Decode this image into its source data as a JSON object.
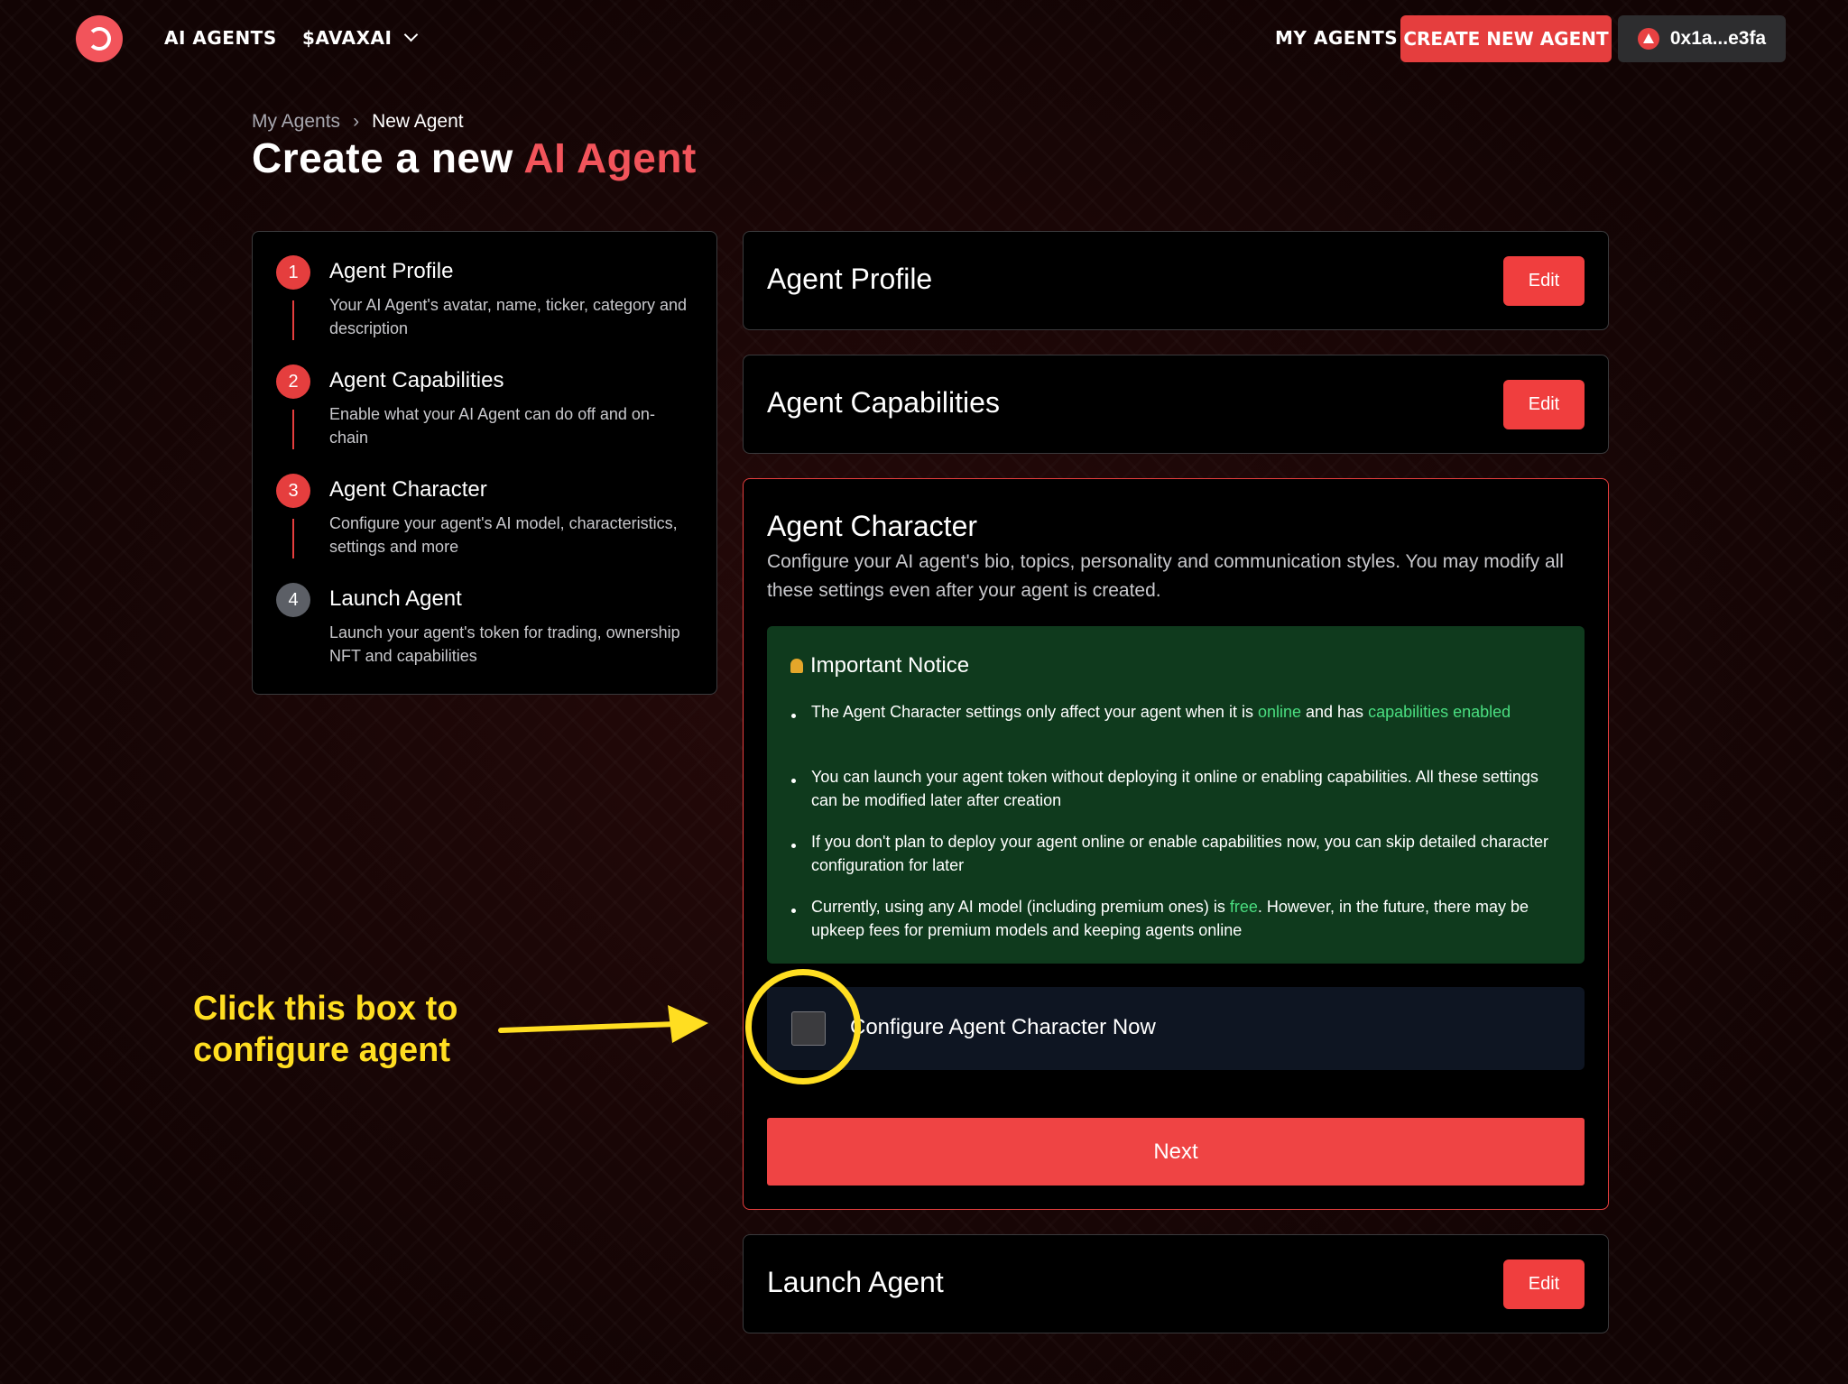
{
  "nav": {
    "links": [
      "AI AGENTS",
      "$AVAXAI"
    ],
    "my_agents": "MY AGENTS",
    "create": "CREATE NEW AGENT",
    "wallet": "0x1a...e3fa"
  },
  "breadcrumb": {
    "parent": "My Agents",
    "current": "New Agent"
  },
  "title": {
    "prefix": "Create a new",
    "highlight": "AI Agent"
  },
  "steps": [
    {
      "num": "1",
      "title": "Agent Profile",
      "desc": "Your AI Agent's avatar, name, ticker, category and description"
    },
    {
      "num": "2",
      "title": "Agent Capabilities",
      "desc": "Enable what your AI Agent can do off and on-chain"
    },
    {
      "num": "3",
      "title": "Agent Character",
      "desc": "Configure your agent's AI model, characteristics, settings and more"
    },
    {
      "num": "4",
      "title": "Launch Agent",
      "desc": "Launch your agent's token for trading, ownership NFT and capabilities"
    }
  ],
  "cards": {
    "profile": {
      "title": "Agent Profile",
      "edit": "Edit"
    },
    "capabilities": {
      "title": "Agent Capabilities",
      "edit": "Edit"
    },
    "character": {
      "title": "Agent Character",
      "desc": "Configure your AI agent's bio, topics, personality and communication styles. You may modify all these settings even after your agent is created."
    },
    "launch": {
      "title": "Launch Agent",
      "edit": "Edit"
    }
  },
  "notice": {
    "title": "Important Notice",
    "b1": {
      "pre": "The Agent Character settings only affect your agent when it is ",
      "g1": "online",
      "mid": " and has ",
      "g2": "capabilities enabled"
    },
    "b2": "You can launch your agent token without deploying it online or enabling capabilities. All these settings can be modified later after creation",
    "b3": "If you don't plan to deploy your agent online or enable capabilities now, you can skip detailed character configuration for later",
    "b4": {
      "pre": "Currently, using any AI model (including premium ones) is ",
      "g": "free",
      "post": ". However, in the future, there may be upkeep fees for premium models and keeping agents online"
    }
  },
  "checkbox": {
    "label": "Configure Agent Character Now",
    "checked": false
  },
  "next": "Next",
  "annotation": {
    "line1": "Click this box to",
    "line2": "configure agent"
  },
  "colors": {
    "accent": "#ef4444",
    "notice_bg": "#0f3a1d",
    "highlight_text": "#4ade80",
    "annotation": "#ffde21"
  }
}
